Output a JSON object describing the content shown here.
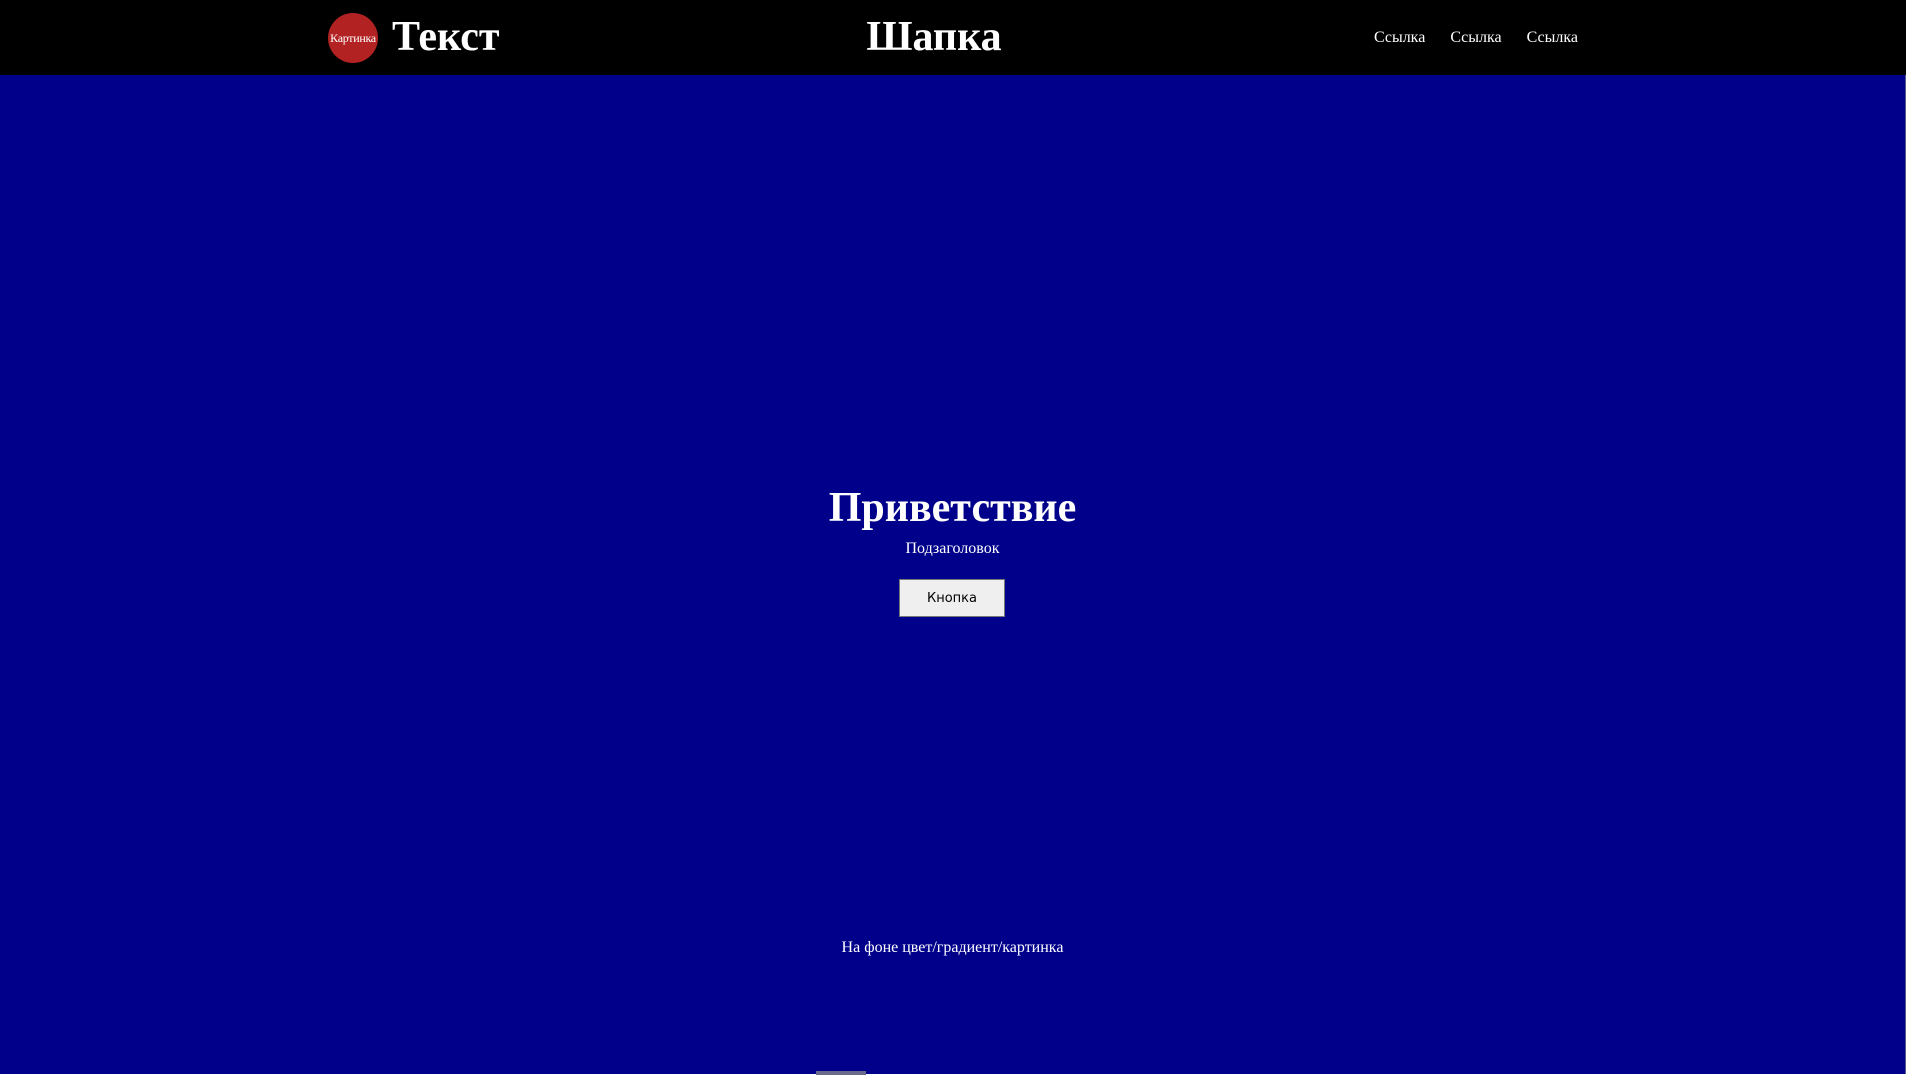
{
  "header": {
    "logo_text": "Картинка",
    "brand_text": "Текст",
    "title": "Шапка",
    "nav_links": [
      {
        "label": "Ссылка"
      },
      {
        "label": "Ссылка"
      },
      {
        "label": "Ссылка"
      }
    ]
  },
  "hero": {
    "title": "Приветствие",
    "subtitle": "Подзаголовок",
    "button_label": "Кнопка",
    "background_note": "На фоне цвет/градиент/картинка"
  },
  "colors": {
    "header_bg": "#000000",
    "hero_bg": "#00008b",
    "logo_bg": "#b22222",
    "text": "#ffffff"
  }
}
